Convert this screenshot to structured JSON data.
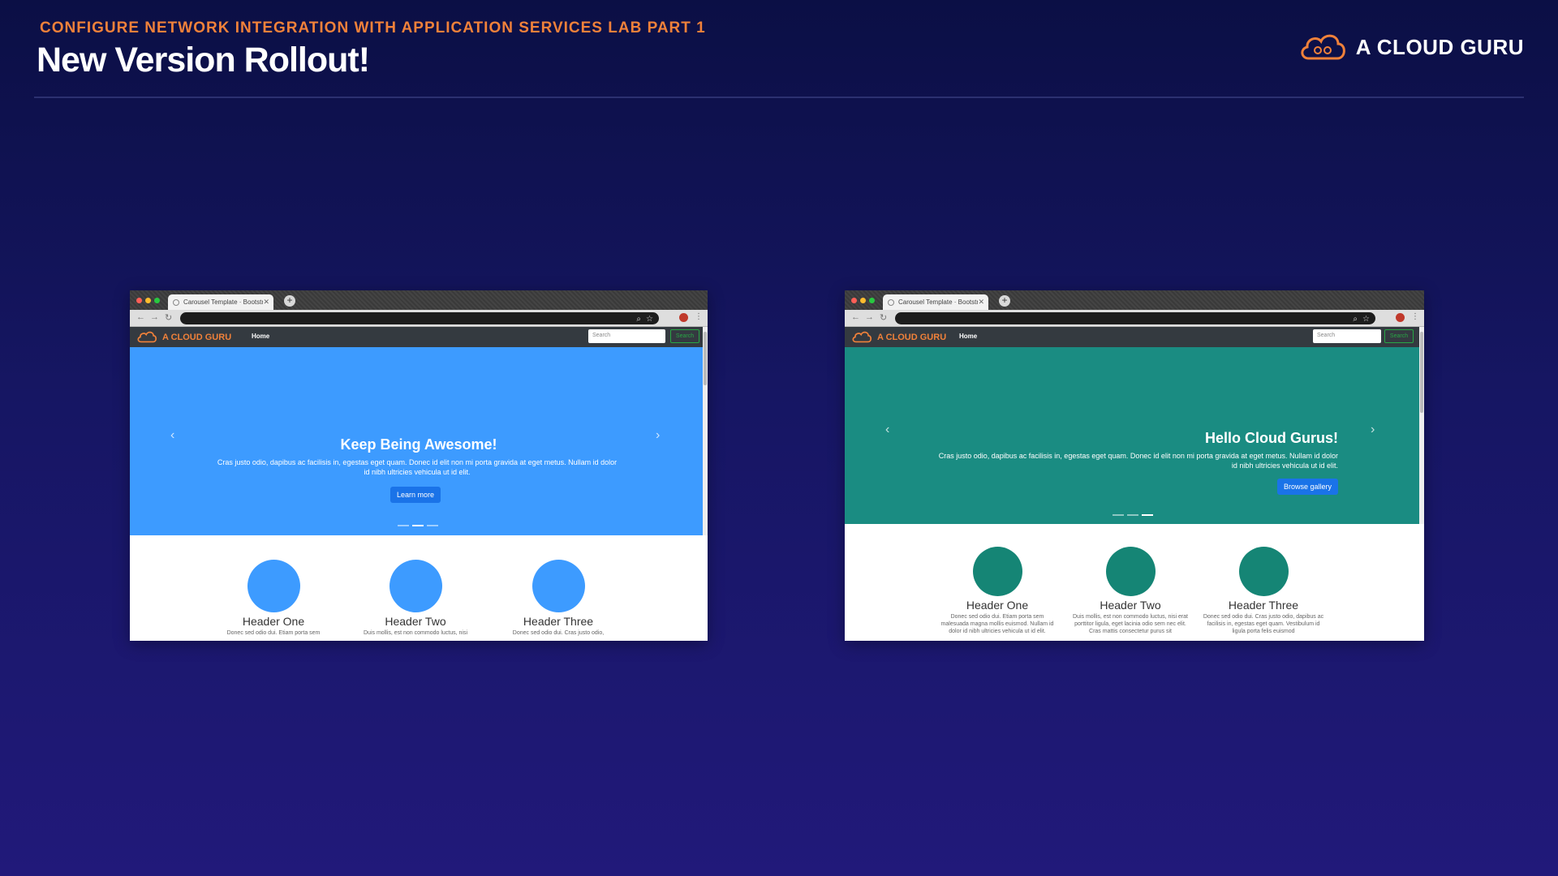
{
  "slide": {
    "subtitle": "CONFIGURE NETWORK INTEGRATION WITH APPLICATION SERVICES LAB PART 1",
    "title": "New Version Rollout!",
    "brand": "A CLOUD GURU"
  },
  "colors": {
    "accent": "#f0813a",
    "old_version_hero": "#3d9bff",
    "new_version_hero": "#1a8c82"
  },
  "browsers": [
    {
      "tab_title": "Carousel Template · Bootstrap",
      "site_brand": "A CLOUD GURU",
      "nav_home": "Home",
      "search_placeholder": "Search",
      "search_button": "Search",
      "hero": {
        "heading": "Keep Being Awesome!",
        "text": "Cras justo odio, dapibus ac facilisis in, egestas eget quam. Donec id elit non mi porta gravida at eget metus. Nullam id dolor id nibh ultricies vehicula ut id elit.",
        "button": "Learn more"
      },
      "features": [
        {
          "title": "Header One",
          "text": "Donec sed odio dui. Etiam porta sem"
        },
        {
          "title": "Header Two",
          "text": "Duis mollis, est non commodo luctus, nisi"
        },
        {
          "title": "Header Three",
          "text": "Donec sed odio dui. Cras justo odio,"
        }
      ]
    },
    {
      "tab_title": "Carousel Template · Bootstrap",
      "site_brand": "A CLOUD GURU",
      "nav_home": "Home",
      "search_placeholder": "Search",
      "search_button": "Search",
      "hero": {
        "heading": "Hello Cloud Gurus!",
        "text": "Cras justo odio, dapibus ac facilisis in, egestas eget quam. Donec id elit non mi porta gravida at eget metus. Nullam id dolor id nibh ultricies vehicula ut id elit.",
        "button": "Browse gallery"
      },
      "features": [
        {
          "title": "Header One",
          "text": "Donec sed odio dui. Etiam porta sem malesuada magna mollis euismod. Nullam id dolor id nibh ultricies vehicula ut id elit."
        },
        {
          "title": "Header Two",
          "text": "Duis mollis, est non commodo luctus, nisi erat porttitor ligula, eget lacinia odio sem nec elit. Cras mattis consectetur purus sit"
        },
        {
          "title": "Header Three",
          "text": "Donec sed odio dui. Cras justo odio, dapibus ac facilisis in, egestas eget quam. Vestibulum id ligula porta felis euismod"
        }
      ]
    }
  ]
}
